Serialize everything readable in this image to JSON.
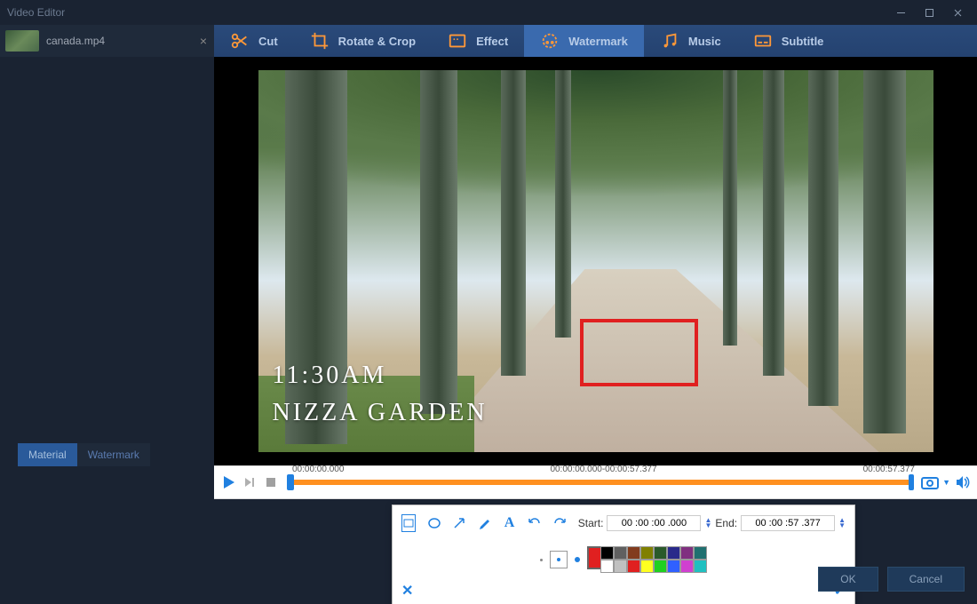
{
  "window": {
    "title": "Video Editor"
  },
  "file_tab": {
    "name": "canada.mp4"
  },
  "ribbon": {
    "cut": "Cut",
    "rotate": "Rotate & Crop",
    "effect": "Effect",
    "watermark": "Watermark",
    "music": "Music",
    "subtitle": "Subtitle"
  },
  "sidebar_tabs": {
    "material": "Material",
    "watermark": "Watermark"
  },
  "preview_overlay": {
    "time": "11:30AM",
    "place": "NIZZA GARDEN"
  },
  "timeline": {
    "start": "00:00:00.000",
    "range": "00:00:00.000-00:00:57.377",
    "end": "00:00:57.377"
  },
  "editor": {
    "start_label": "Start:",
    "start_value": "00 :00 :00 .000",
    "end_label": "End:",
    "end_value": "00 :00 :57 .377",
    "palette_selected": "#e02020",
    "palette": [
      "#000000",
      "#606060",
      "#823c1e",
      "#808000",
      "#2a5a2a",
      "#2a2a8a",
      "#803080",
      "#207070",
      "#ffffff",
      "#c0c0c0",
      "#e02020",
      "#ffff20",
      "#20d020",
      "#3060ff",
      "#d040d0",
      "#20c0c0"
    ]
  },
  "footer": {
    "ok": "OK",
    "cancel": "Cancel"
  }
}
